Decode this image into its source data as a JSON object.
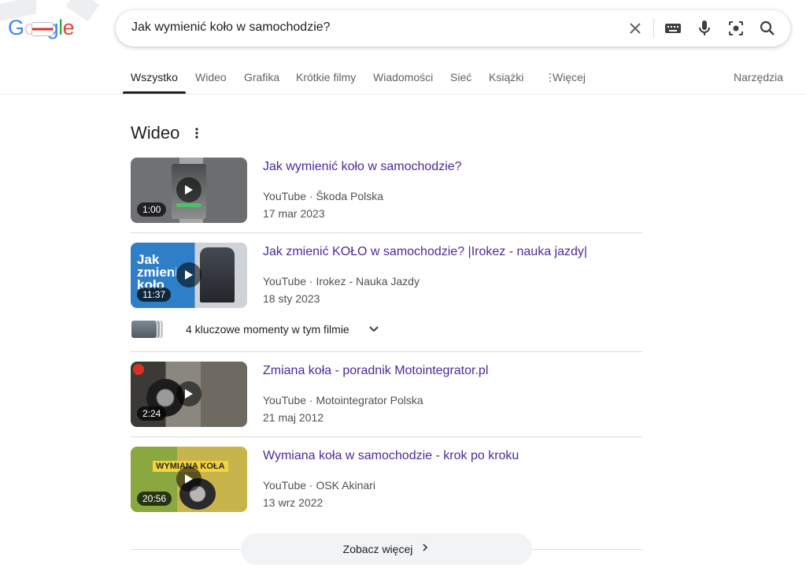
{
  "header": {
    "logo_text": "Google",
    "search": {
      "value": "Jak wymienić koło w samochodzie?",
      "clear_icon": "close-icon",
      "keyboard_icon": "keyboard-icon",
      "voice_icon": "microphone-icon",
      "lens_icon": "camera-lens-icon",
      "search_icon": "search-icon"
    }
  },
  "tabs": [
    {
      "label": "Wszystko",
      "active": true
    },
    {
      "label": "Wideo"
    },
    {
      "label": "Grafika"
    },
    {
      "label": "Krótkie filmy"
    },
    {
      "label": "Wiadomości"
    },
    {
      "label": "Sieć"
    },
    {
      "label": "Książki"
    },
    {
      "label": "Więcej"
    }
  ],
  "tools_label": "Narzędzia",
  "section": {
    "title": "Wideo"
  },
  "videos": [
    {
      "title": "Jak wymienić koło w samochodzie?",
      "source": "YouTube · Škoda Polska",
      "date": "17 mar 2023",
      "duration": "1:00"
    },
    {
      "title": "Jak zmienić KOŁO w samochodzie? |Irokez - nauka jazdy|",
      "source": "YouTube · Irokez - Nauka Jazdy",
      "date": "18 sty 2023",
      "duration": "11:37",
      "thumb_text": "Jak zmienić koło"
    },
    {
      "title": "Zmiana koła - poradnik Motointegrator.pl",
      "source": "YouTube · Motointegrator Polska",
      "date": "21 maj 2012",
      "duration": "2:24"
    },
    {
      "title": "Wymiana koła w samochodzie - krok po kroku",
      "source": "YouTube · OSK Akinari",
      "date": "13 wrz 2022",
      "duration": "20:56",
      "thumb_text": "WYMIANA KOŁA"
    }
  ],
  "key_moments": {
    "label": "4 kluczowe momenty w tym filmie"
  },
  "see_more": {
    "label": "Zobacz więcej"
  },
  "colors": {
    "link": "#4c2a9b",
    "meta": "#4d5156",
    "tab_inactive": "#5f6368"
  }
}
